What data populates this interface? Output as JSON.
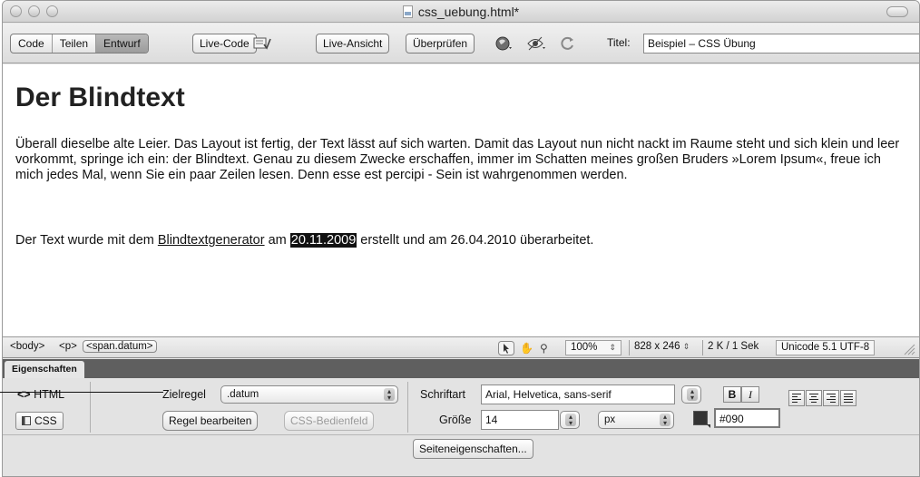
{
  "window": {
    "title": "css_uebung.html*"
  },
  "toolbar": {
    "view_tabs": [
      "Code",
      "Teilen",
      "Entwurf"
    ],
    "live_code": "Live-Code",
    "live_view": "Live-Ansicht",
    "check": "Überprüfen",
    "title_label": "Titel:",
    "title_value": "Beispiel – CSS Übung"
  },
  "document": {
    "heading": "Der Blindtext",
    "paragraph1": "Überall dieselbe alte Leier. Das Layout ist fertig, der Text lässt auf sich warten. Damit das Layout nun nicht nackt im Raume steht und sich klein und leer vorkommt, springe ich ein: der Blindtext. Genau zu diesem Zwecke erschaffen, immer im Schatten meines großen Bruders »Lorem Ipsum«, freue ich mich jedes Mal, wenn Sie ein paar Zeilen lesen. Denn esse est percipi - Sein ist wahrgenommen werden.",
    "p2_before": "Der Text wurde mit dem ",
    "p2_link": "Blindtextgenerator",
    "p2_mid": " am ",
    "p2_date": "20.11.2009",
    "p2_after": " erstellt und am 26.04.2010 überarbeitet."
  },
  "statusbar": {
    "tag_body": "<body>",
    "tag_p": "<p>",
    "tag_span": "<span.datum>",
    "zoom": "100%",
    "window_size": "828 x 246",
    "download": "2 K / 1 Sek",
    "encoding": "Unicode 5.1 UTF-8"
  },
  "panel": {
    "tab": "Eigenschaften",
    "html_label": "HTML",
    "css_label": "CSS",
    "target_rule_label": "Zielregel",
    "target_rule_value": ".datum",
    "edit_rule": "Regel bearbeiten",
    "css_panel": "CSS-Bedienfeld",
    "font_label": "Schriftart",
    "font_value": "Arial, Helvetica, sans-serif",
    "size_label": "Größe",
    "size_value": "14",
    "unit_value": "px",
    "color_value": "#090",
    "bold": "B",
    "italic": "I",
    "page_props": "Seiteneigenschaften..."
  },
  "colors": {
    "highlight": "#111111",
    "color_swatch": "#333333"
  }
}
